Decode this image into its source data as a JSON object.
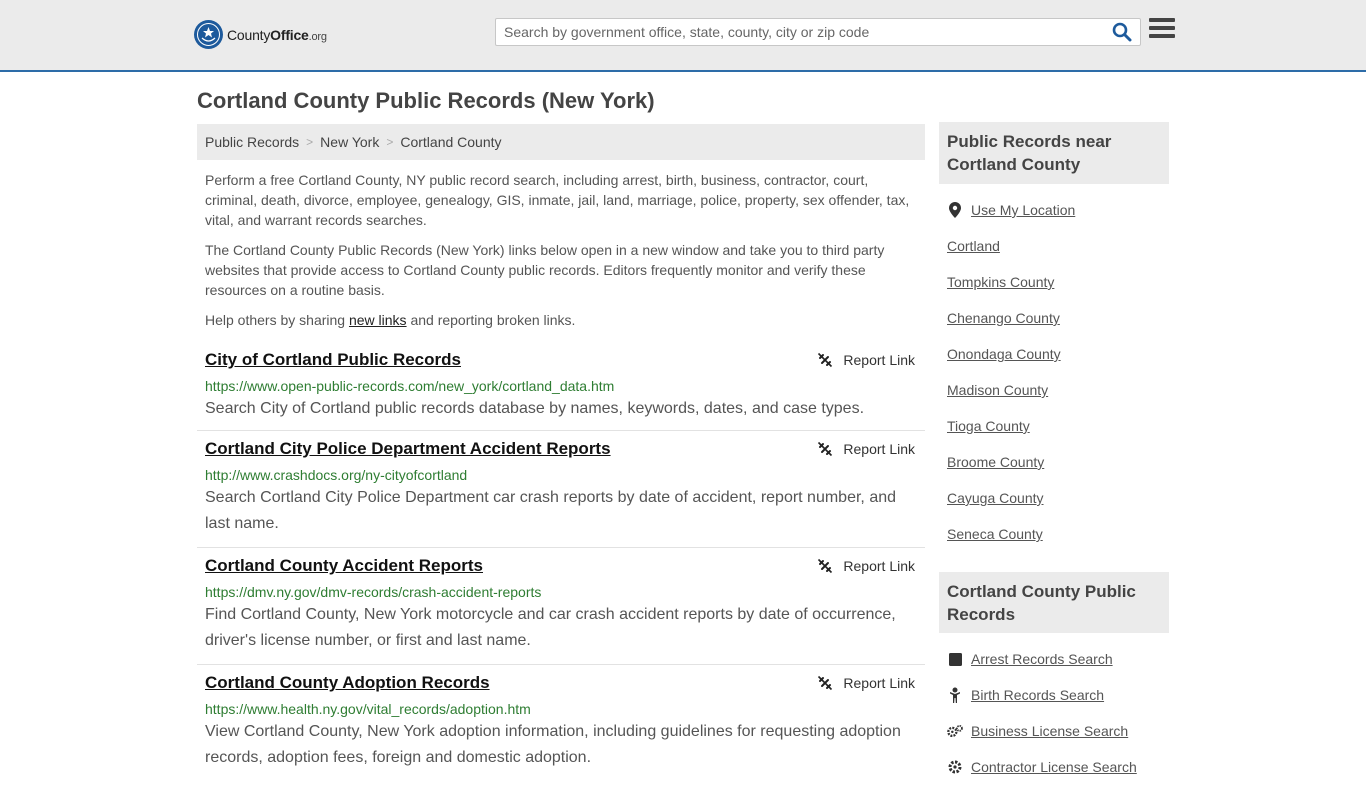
{
  "header": {
    "logo_main": "County",
    "logo_bold": "Office",
    "logo_tld": ".org",
    "search_placeholder": "Search by government office, state, county, city or zip code"
  },
  "page_title": "Cortland County Public Records (New York)",
  "breadcrumb": [
    "Public Records",
    "New York",
    "Cortland County"
  ],
  "intro": {
    "p1": "Perform a free Cortland County, NY public record search, including arrest, birth, business, contractor, court, criminal, death, divorce, employee, genealogy, GIS, inmate, jail, land, marriage, police, property, sex offender, tax, vital, and warrant records searches.",
    "p2": "The Cortland County Public Records (New York) links below open in a new window and take you to third party websites that provide access to Cortland County public records. Editors frequently monitor and verify these resources on a routine basis.",
    "p3_before": "Help others by sharing ",
    "p3_link": "new links",
    "p3_after": " and reporting broken links."
  },
  "report_label": "Report Link",
  "records": [
    {
      "title": "City of Cortland Public Records",
      "url": "https://www.open-public-records.com/new_york/cortland_data.htm",
      "desc": "Search City of Cortland public records database by names, keywords, dates, and case types."
    },
    {
      "title": "Cortland City Police Department Accident Reports",
      "url": "http://www.crashdocs.org/ny-cityofcortland",
      "desc": "Search Cortland City Police Department car crash reports by date of accident, report number, and last name."
    },
    {
      "title": "Cortland County Accident Reports",
      "url": "https://dmv.ny.gov/dmv-records/crash-accident-reports",
      "desc": "Find Cortland County, New York motorcycle and car crash accident reports by date of occurrence, driver's license number, or first and last name."
    },
    {
      "title": "Cortland County Adoption Records",
      "url": "https://www.health.ny.gov/vital_records/adoption.htm",
      "desc": "View Cortland County, New York adoption information, including guidelines for requesting adoption records, adoption fees, foreign and domestic adoption."
    }
  ],
  "sidebar": {
    "near_title": "Public Records near Cortland County",
    "use_location": "Use My Location",
    "near_items": [
      "Cortland",
      "Tompkins County",
      "Chenango County",
      "Onondaga County",
      "Madison County",
      "Tioga County",
      "Broome County",
      "Cayuga County",
      "Seneca County"
    ],
    "county_title": "Cortland County Public Records",
    "county_items": [
      {
        "label": "Arrest Records Search",
        "icon": "square-icon"
      },
      {
        "label": "Birth Records Search",
        "icon": "child-icon"
      },
      {
        "label": "Business License Search",
        "icon": "cogs-icon"
      },
      {
        "label": "Contractor License Search",
        "icon": "gear-icon"
      }
    ]
  },
  "colors": {
    "accent": "#2d6ca8",
    "url_green": "#2e7d32",
    "header_bg": "#ebebeb"
  }
}
